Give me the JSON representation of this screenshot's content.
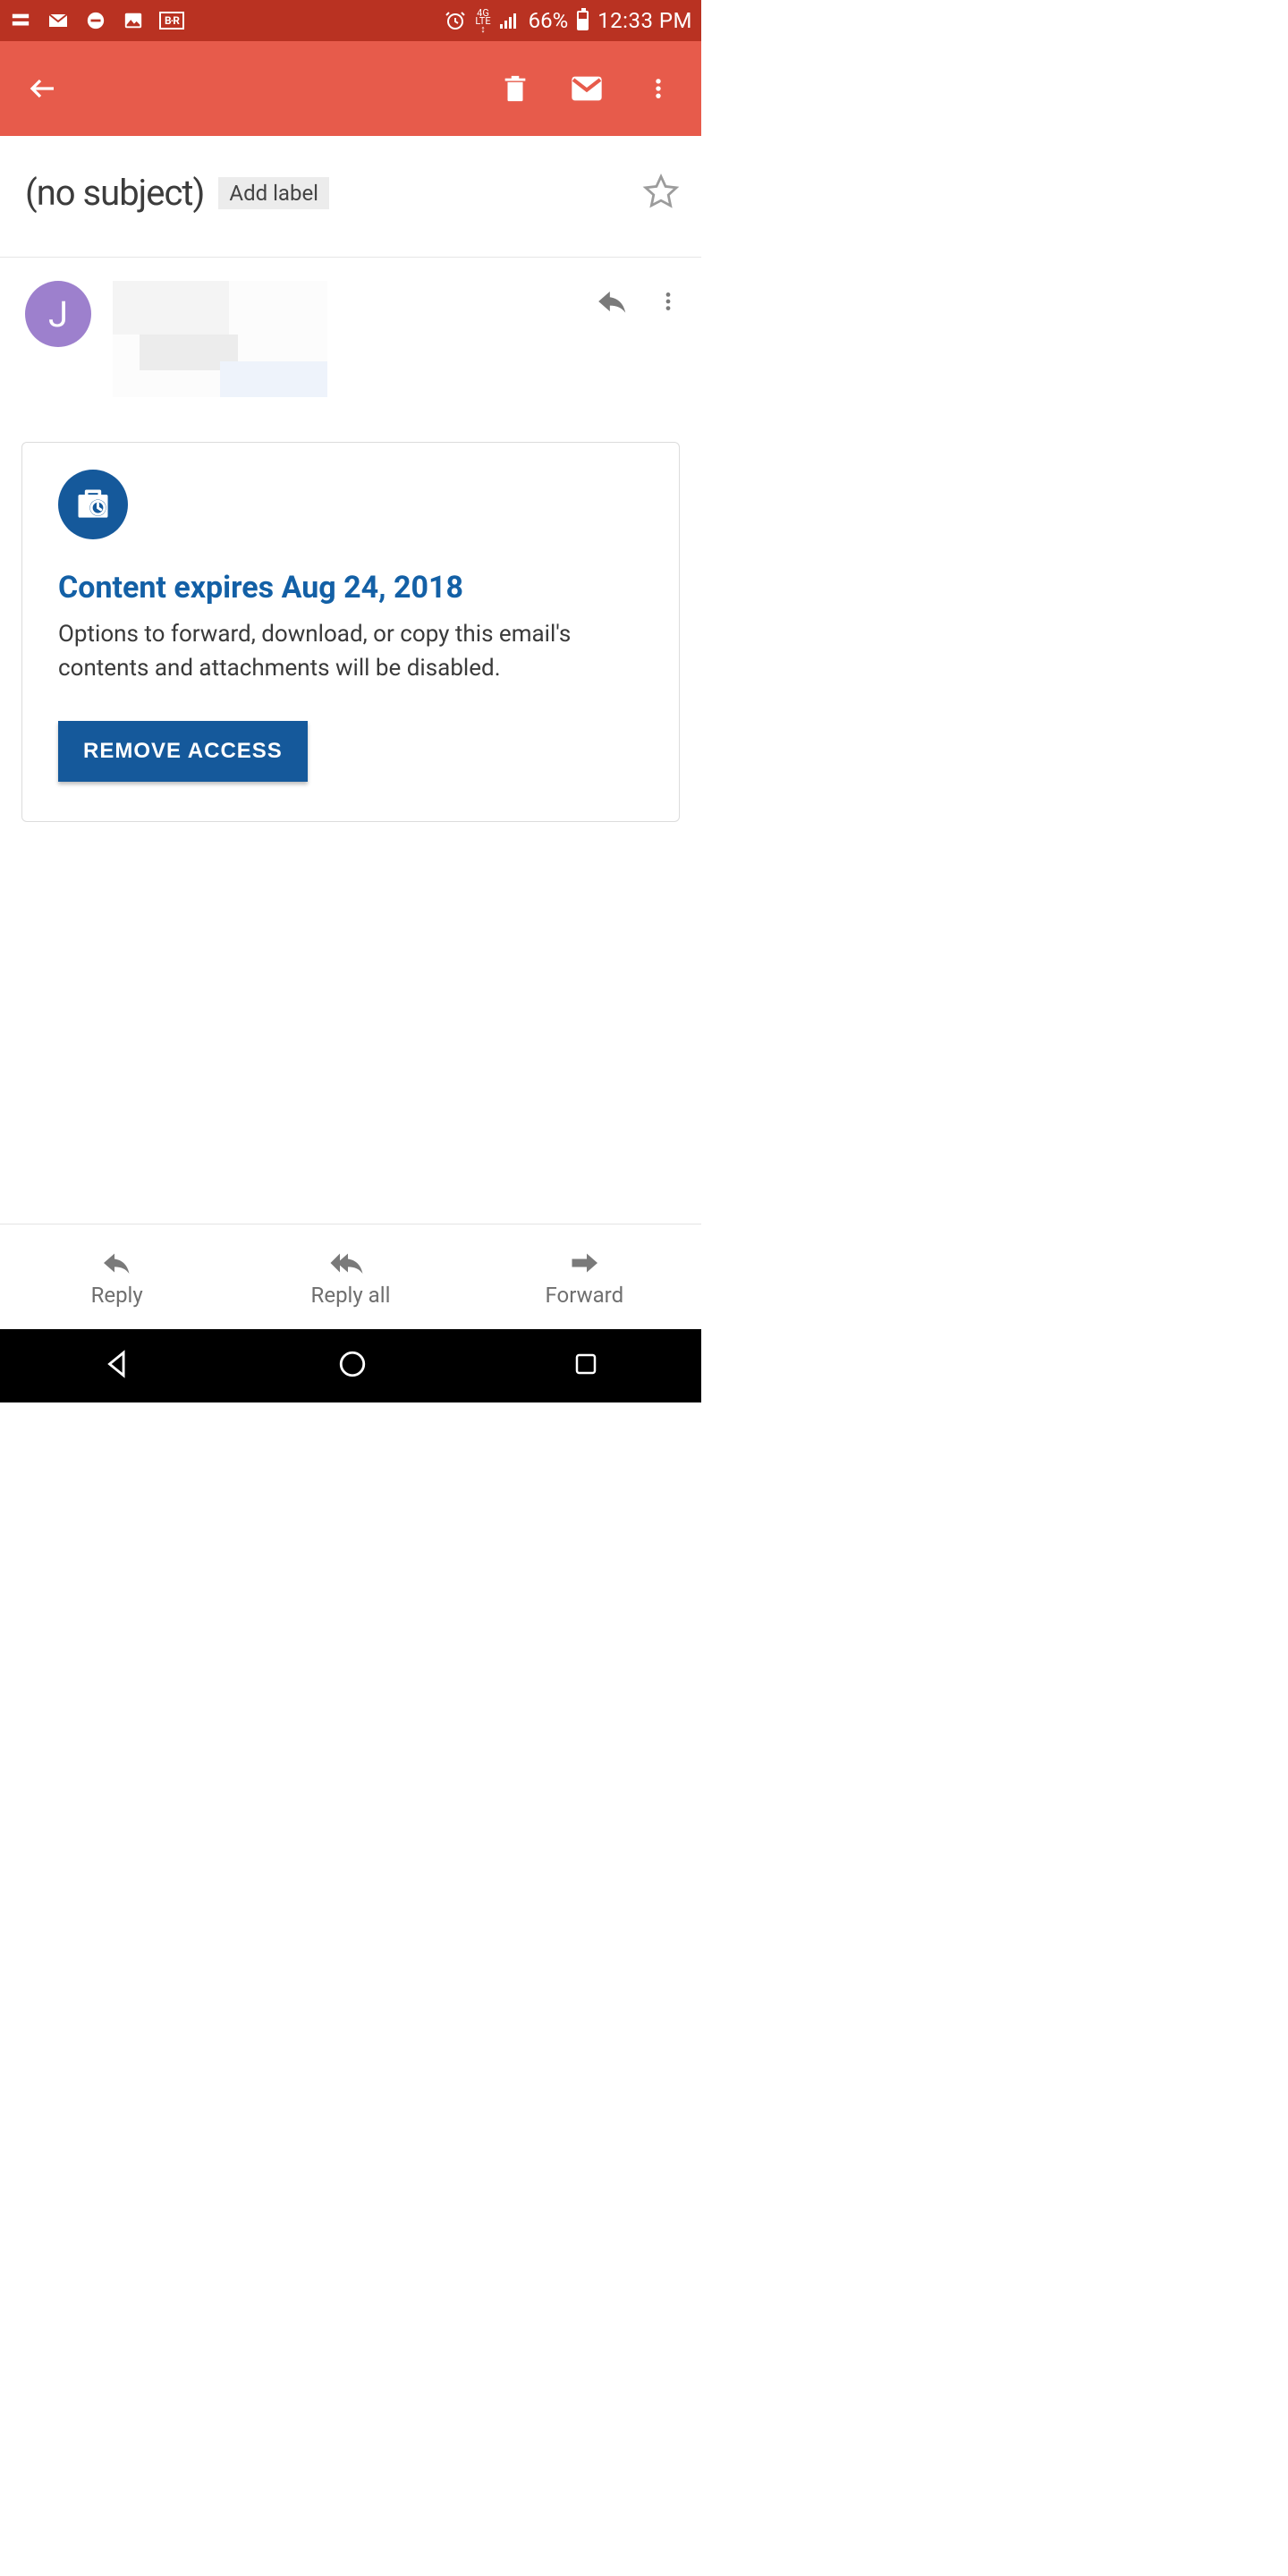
{
  "status": {
    "network_label": "4G LTE",
    "battery_pct": "66%",
    "time": "12:33 PM"
  },
  "subject": {
    "text": "(no subject)",
    "add_label": "Add label"
  },
  "sender": {
    "avatar_initial": "J"
  },
  "confidential": {
    "title": "Content expires Aug 24, 2018",
    "body": "Options to forward, download, or copy this email's contents and attachments will be disabled.",
    "button": "REMOVE ACCESS"
  },
  "actions": {
    "reply": "Reply",
    "reply_all": "Reply all",
    "forward": "Forward"
  }
}
